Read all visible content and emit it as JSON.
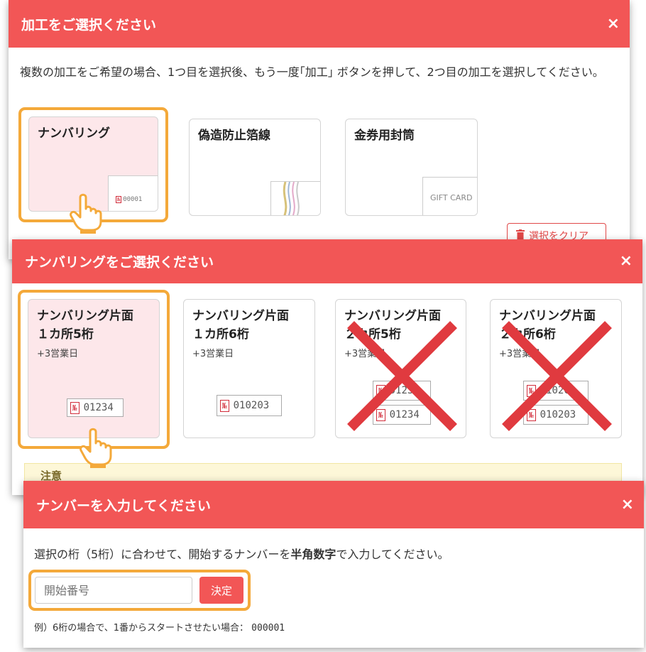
{
  "dialog1": {
    "title": "加工をご選択ください",
    "close": "×",
    "description": "複数の加工をご希望の場合、1つ目を選択後、もう一度｢加工｣ ボタンを押して、2つ目の加工を選択してください。",
    "options": [
      {
        "label": "ナンバリング",
        "thumb_no": "№",
        "thumb_value": "00001",
        "selected": true
      },
      {
        "label": "偽造防止箔線",
        "selected": false
      },
      {
        "label": "金券用封筒",
        "thumb_text": "GIFT CARD",
        "selected": false
      }
    ],
    "clear_button": "選択をクリア"
  },
  "dialog2": {
    "title": "ナンバリングをご選択ください",
    "close": "×",
    "options": [
      {
        "title": "ナンバリング片面\n１カ所5桁",
        "sub": "+3営業日",
        "no": "№",
        "values": [
          "01234"
        ],
        "selected": true,
        "available": true
      },
      {
        "title": "ナンバリング片面\n１カ所6桁",
        "sub": "+3営業日",
        "no": "№",
        "values": [
          "010203"
        ],
        "selected": false,
        "available": true
      },
      {
        "title": "ナンバリング片面\n２カ所5桁",
        "sub": "+3営業日",
        "no": "№",
        "values": [
          "01234",
          "01234"
        ],
        "selected": false,
        "available": false
      },
      {
        "title": "ナンバリング片面\n２カ所6桁",
        "sub": "+3営業日",
        "no": "№",
        "values": [
          "010203",
          "010203"
        ],
        "selected": false,
        "available": false
      }
    ],
    "note_title": "注意"
  },
  "dialog3": {
    "title": "ナンバーを入力してください",
    "close": "×",
    "instruction_pre": "選択の桁（5桁）に合わせて、開始するナンバーを",
    "instruction_bold": "半角数字",
    "instruction_post": "で入力してください。",
    "input_value": "",
    "input_placeholder": "開始番号",
    "submit": "決定",
    "example_pre": "例）6桁の場合で、1番からスタートさせたい場合：",
    "example_value": "000001"
  },
  "colors": {
    "header": "#f25656",
    "highlight": "#f4a93a",
    "selected_card": "#fde7ea",
    "cross": "#e03a3f"
  }
}
